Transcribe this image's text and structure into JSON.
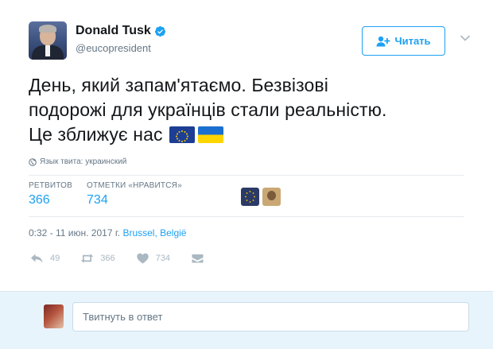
{
  "author": {
    "name": "Donald Tusk",
    "handle": "@eucopresident",
    "verified": true
  },
  "follow_button": {
    "label": "Читать",
    "icon": "person-plus-icon"
  },
  "menu": {
    "icon": "chevron-down-icon"
  },
  "tweet": {
    "line1": "День, який запам'ятаємо. Безвізові",
    "line2": "подорожі для українців стали реальністю.",
    "line3": "Це зближує нас",
    "emoji": [
      "eu-flag",
      "ukraine-flag"
    ]
  },
  "language_note": "Язык твита: украинский",
  "stats": {
    "retweets_label": "РЕТВИТОВ",
    "retweets_value": "366",
    "likes_label": "ОТМЕТКИ «НРАВИТСЯ»",
    "likes_value": "734"
  },
  "timestamp": {
    "time": "0:32 - 11 июн. 2017 г.",
    "location": "Brussel, België"
  },
  "actions": {
    "reply_count": "49",
    "retweet_count": "366",
    "like_count": "734"
  },
  "reply": {
    "placeholder": "Твитнуть в ответ"
  },
  "colors": {
    "accent": "#1da1f2",
    "text": "#14171a",
    "muted": "#657786",
    "icon_muted": "#aab8c2",
    "reply_bg": "#e8f4fb"
  }
}
